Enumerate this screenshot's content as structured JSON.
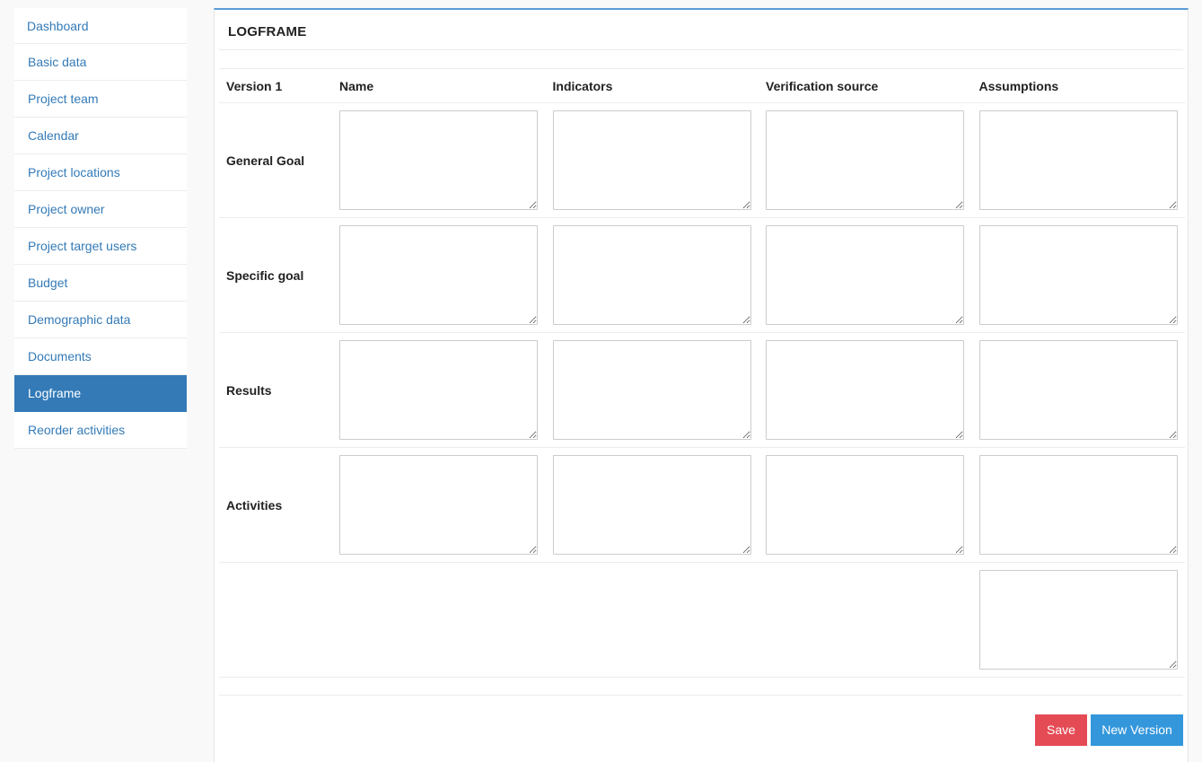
{
  "sidebar": {
    "items": [
      {
        "label": "Dashboard"
      },
      {
        "label": "Basic data"
      },
      {
        "label": "Project team"
      },
      {
        "label": "Calendar"
      },
      {
        "label": "Project locations"
      },
      {
        "label": "Project owner"
      },
      {
        "label": "Project target users"
      },
      {
        "label": "Budget"
      },
      {
        "label": "Demographic data"
      },
      {
        "label": "Documents"
      },
      {
        "label": "Logframe",
        "active": true
      },
      {
        "label": "Reorder activities"
      }
    ]
  },
  "panel": {
    "title": "LOGFRAME"
  },
  "table": {
    "headers": [
      "Version 1",
      "Name",
      "Indicators",
      "Verification source",
      "Assumptions"
    ],
    "rows": [
      {
        "label": "General Goal"
      },
      {
        "label": "Specific goal"
      },
      {
        "label": "Results"
      },
      {
        "label": "Activities"
      }
    ]
  },
  "buttons": {
    "save_label": "Save",
    "new_version_label": "New Version"
  },
  "colors": {
    "accent": "#337ab7",
    "save": "#e54b55",
    "new_version": "#3497db",
    "panel_top_border": "#5b9bd5"
  }
}
